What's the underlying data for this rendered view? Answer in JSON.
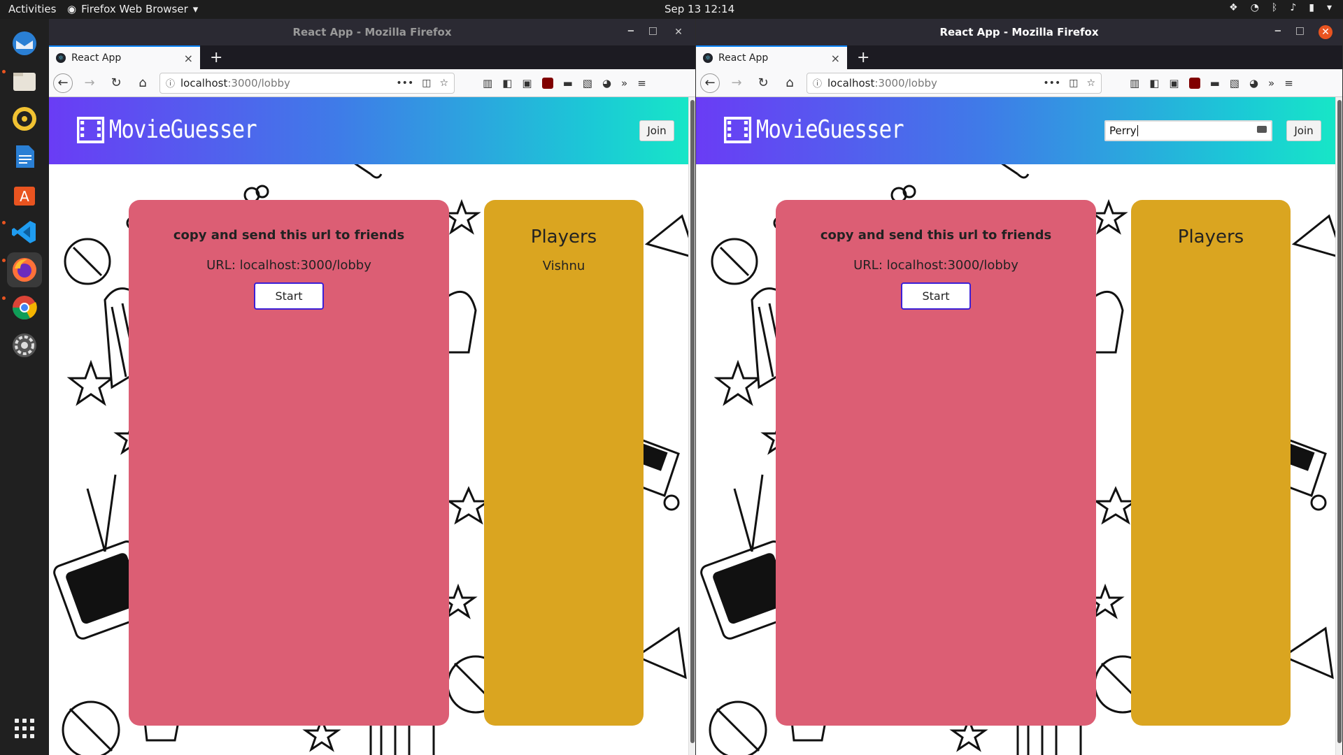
{
  "topbar": {
    "activities": "Activities",
    "app_menu": "Firefox Web Browser",
    "clock": "Sep 13  12:14"
  },
  "dock": {
    "items": [
      "thunderbird-icon",
      "files-icon",
      "rhythmbox-icon",
      "writer-icon",
      "software-icon",
      "vscode-icon",
      "firefox-icon",
      "chrome-icon",
      "settings-icon",
      "app-grid-icon"
    ]
  },
  "windows": [
    {
      "title": "React App - Mozilla Firefox",
      "tab_label": "React App",
      "url_host": "localhost",
      "url_path": ":3000/lobby",
      "site": {
        "logo": "MovieGuesser",
        "join_label": "Join",
        "name_input_value": "",
        "copy_text": "copy and send this url to friends",
        "url_text": "URL: localhost:3000/lobby",
        "start_label": "Start",
        "players_title": "Players",
        "players": [
          "Vishnu"
        ]
      }
    },
    {
      "title": "React App - Mozilla Firefox",
      "tab_label": "React App",
      "url_host": "localhost",
      "url_path": ":3000/lobby",
      "site": {
        "logo": "MovieGuesser",
        "join_label": "Join",
        "name_input_value": "Perry",
        "copy_text": "copy and send this url to friends",
        "url_text": "URL: localhost:3000/lobby",
        "start_label": "Start",
        "players_title": "Players",
        "players": []
      }
    }
  ],
  "colors": {
    "lobby_card": "#dc5e74",
    "players_card": "#daa520",
    "start_border": "#3b1fd6",
    "header_gradient_start": "#6a3cf5",
    "header_gradient_end": "#17e6c7"
  }
}
